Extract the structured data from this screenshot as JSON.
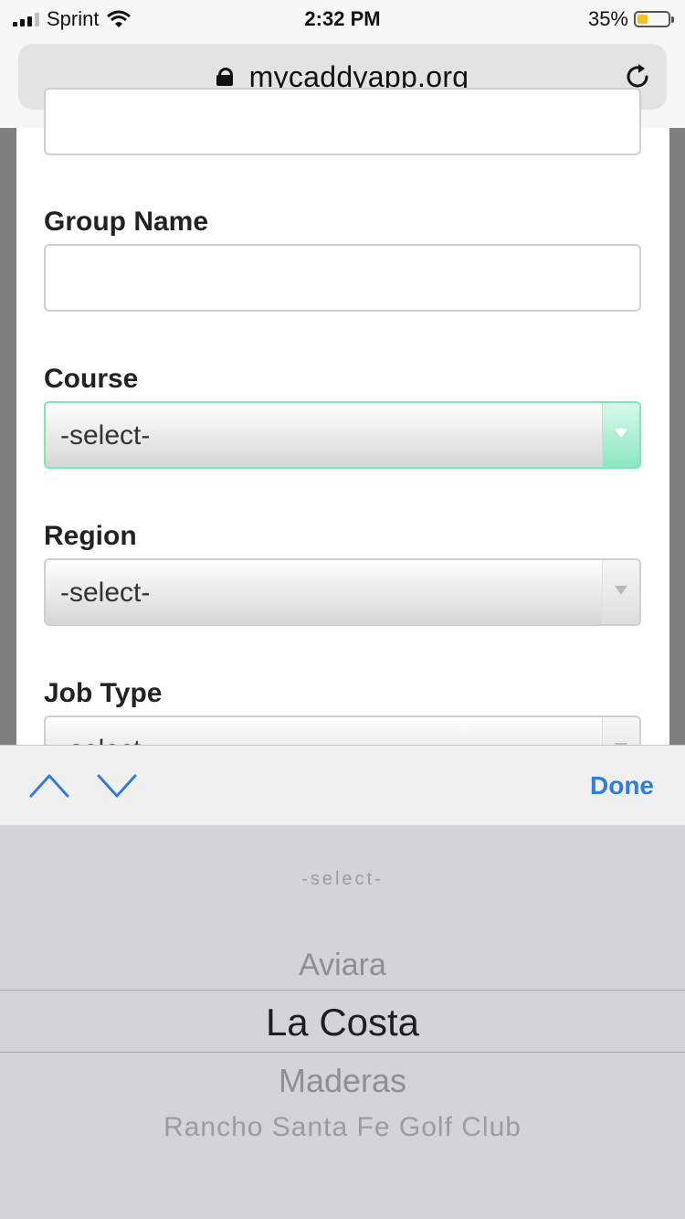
{
  "status_bar": {
    "carrier": "Sprint",
    "time": "2:32 PM",
    "battery_percent": "35%",
    "battery_level": 0.35
  },
  "browser": {
    "url": "mycaddyapp.org"
  },
  "form": {
    "group_name_label": "Group Name",
    "group_name_value": "",
    "course_label": "Course",
    "course_value": "-select-",
    "region_label": "Region",
    "region_value": "-select-",
    "job_type_label": "Job Type",
    "job_type_value": "-select-"
  },
  "accessory": {
    "done_label": "Done"
  },
  "picker": {
    "options": [
      "-select-",
      "Aviara",
      "La Costa",
      "Maderas",
      "Rancho Santa Fe Golf Club"
    ],
    "selected": "La Costa"
  },
  "colors": {
    "accent": "#2f7de1",
    "focus": "#7de6b7",
    "battery": "#f5c12a"
  }
}
